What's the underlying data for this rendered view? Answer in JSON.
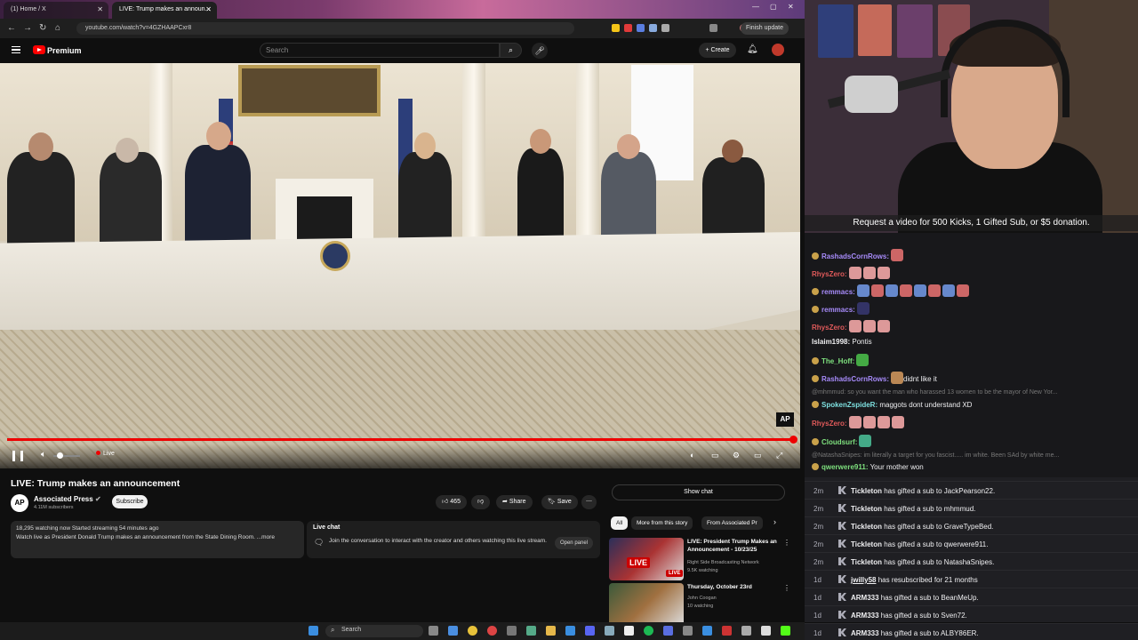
{
  "browser": {
    "tabs": [
      {
        "label": "(1) Home / X"
      },
      {
        "label": "LIVE: Trump makes an announ..."
      }
    ],
    "url": "youtube.com/watch?v=4GZHAAPCxr8",
    "finish_update": "Finish update"
  },
  "youtube": {
    "brand": "Premium",
    "search_placeholder": "Search",
    "create_label": "+ Create"
  },
  "video": {
    "watermark": "AP",
    "live_label": "Live",
    "title": "LIVE: Trump makes an announcement",
    "channel": "Associated Press",
    "channel_logo": "AP",
    "subscribers": "4.11M subscribers",
    "subscribe_label": "Subscribe",
    "likes": "465",
    "share_label": "Share",
    "save_label": "Save",
    "description_line1": "18,295 watching now  Started streaming 54 minutes ago",
    "description_line2": "Watch live as President Donald Trump makes an announcement from the State Dining Room. ...more",
    "live_chat_label": "Live chat",
    "live_chat_text": "Join the conversation to interact with the creator and others watching this live stream.",
    "open_panel_label": "Open panel"
  },
  "sidebar": {
    "show_chat": "Show chat",
    "chips": [
      "All",
      "More from this story",
      "From Associated Pr"
    ],
    "recommendations": [
      {
        "title": "LIVE: President Trump Makes an Announcement - 10/23/25",
        "channel": "Right Side Broadcasting Network",
        "meta": "9.5K watching",
        "thumb_tag": "LIVE"
      },
      {
        "title": "Thursday, October 23rd",
        "channel": "John Coogan",
        "meta": "10 watching",
        "thumb_tag": ""
      }
    ]
  },
  "stream": {
    "kicks_banner": "Request a video for 500 Kicks, 1 Gifted Sub, or $5 donation.",
    "chat": [
      {
        "user": "RashadsCornRows:",
        "text": "",
        "color": "#a78bfa"
      },
      {
        "user": "RhysZero:",
        "text": "",
        "color": "#e05a5a"
      },
      {
        "user": "remmacs:",
        "text": "",
        "color": "#a78bfa"
      },
      {
        "user": "remmacs:",
        "text": "",
        "color": "#a78bfa"
      },
      {
        "user": "RhysZero:",
        "text": "",
        "color": "#e05a5a"
      },
      {
        "user": "Islaim1998:",
        "text": "Pontis",
        "color": "#efeff1"
      },
      {
        "user": "The_Hoff:",
        "text": "",
        "color": "#7ee07e"
      },
      {
        "user": "RashadsCornRows:",
        "text": "didnt like it",
        "color": "#a78bfa"
      },
      {
        "user": "@mhmmud:",
        "text": "so you want the man who harassed 13 women to be the mayor of New Yor...",
        "color": "#777"
      },
      {
        "user": "SpokenZspideR:",
        "text": "maggots dont understand XD",
        "color": "#7ee0e0"
      },
      {
        "user": "RhysZero:",
        "text": "",
        "color": "#e05a5a"
      },
      {
        "user": "Cloudsurf:",
        "text": "",
        "color": "#7ee07e"
      },
      {
        "user": "@NatashaSnipes:",
        "text": "im literally a target for you fascist..... im white. Been SAd by white me...",
        "color": "#777"
      },
      {
        "user": "qwerwere911:",
        "text": "Your mother won",
        "color": "#7ee07e"
      }
    ],
    "events": [
      {
        "age": "2m",
        "user": "Tickleton",
        "text": " has gifted a sub to JackPearson22."
      },
      {
        "age": "2m",
        "user": "Tickleton",
        "text": " has gifted a sub to mhmmud."
      },
      {
        "age": "2m",
        "user": "Tickleton",
        "text": " has gifted a sub to GraveTypeBed."
      },
      {
        "age": "2m",
        "user": "Tickleton",
        "text": " has gifted a sub to qwerwere911."
      },
      {
        "age": "2m",
        "user": "Tickleton",
        "text": " has gifted a sub to NatashaSnipes."
      },
      {
        "age": "1d",
        "user": "jwilly58",
        "text": " has resubscribed for 21 months"
      },
      {
        "age": "1d",
        "user": "ARM333",
        "text": " has gifted a sub to BeanMeUp."
      },
      {
        "age": "1d",
        "user": "ARM333",
        "text": " has gifted a sub to Sven72."
      },
      {
        "age": "1d",
        "user": "ARM333",
        "text": " has gifted a sub to ALBY86ER."
      }
    ]
  },
  "taskbar": {
    "search_label": "Search"
  }
}
